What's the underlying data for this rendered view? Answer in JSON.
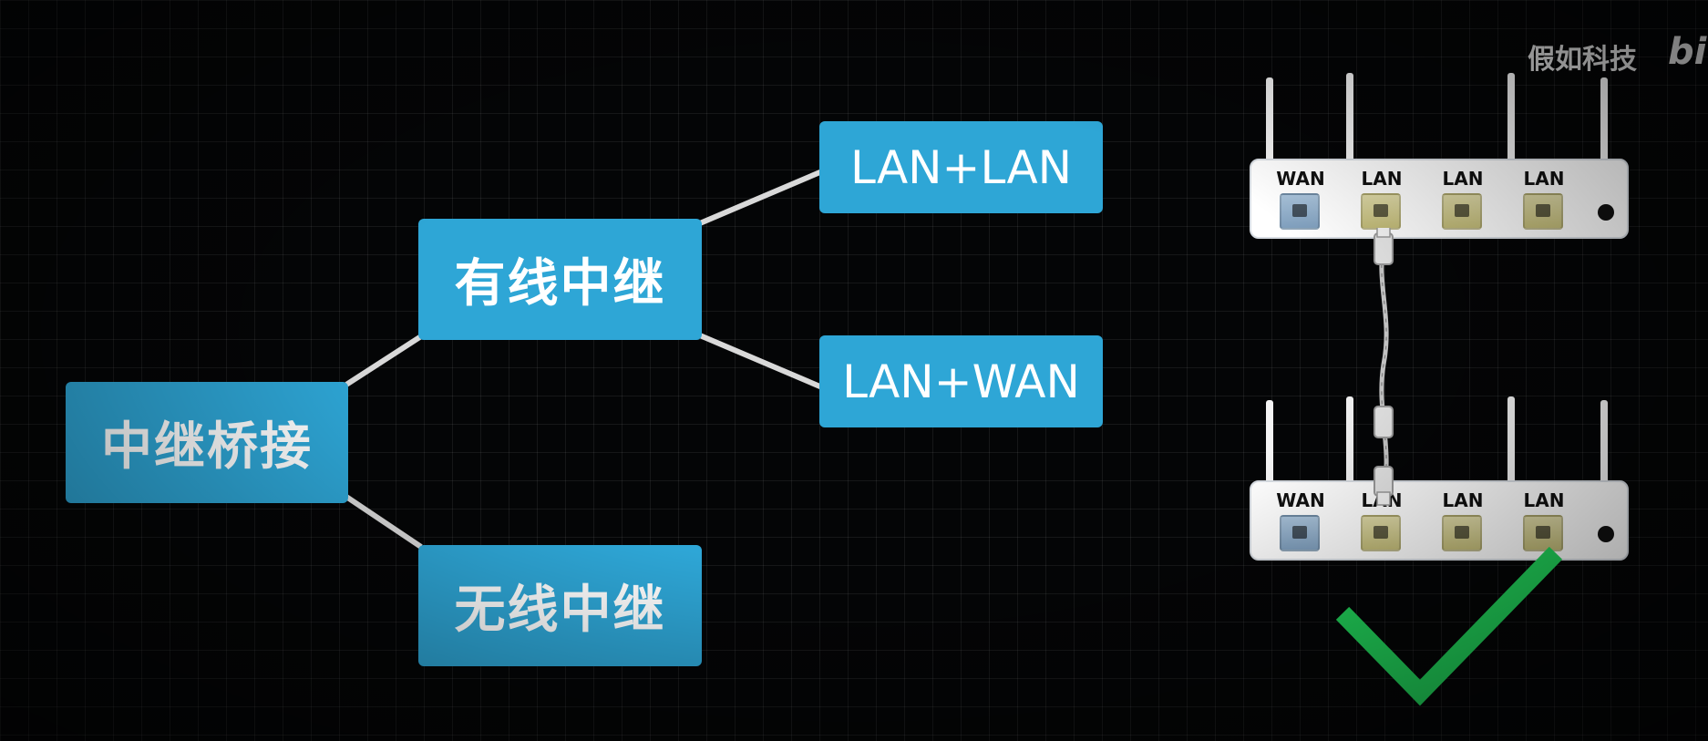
{
  "diagram": {
    "root": "中继桥接",
    "wired": "有线中继",
    "wireless": "无线中继",
    "lan_lan": "LAN+LAN",
    "lan_wan": "LAN+WAN"
  },
  "watermark": {
    "text": "假如科技",
    "logo": "bi"
  },
  "routers": {
    "top": {
      "ports": [
        "WAN",
        "LAN",
        "LAN",
        "LAN"
      ]
    },
    "bottom": {
      "ports": [
        "WAN",
        "LAN",
        "LAN",
        "LAN"
      ]
    }
  },
  "colors": {
    "node": "#2ea6d6",
    "connector": "#d9d9d9",
    "check": "#21d35a",
    "background": "#040506"
  },
  "icons": [
    "checkmark-icon",
    "ethernet-cable-icon",
    "router-icon"
  ]
}
